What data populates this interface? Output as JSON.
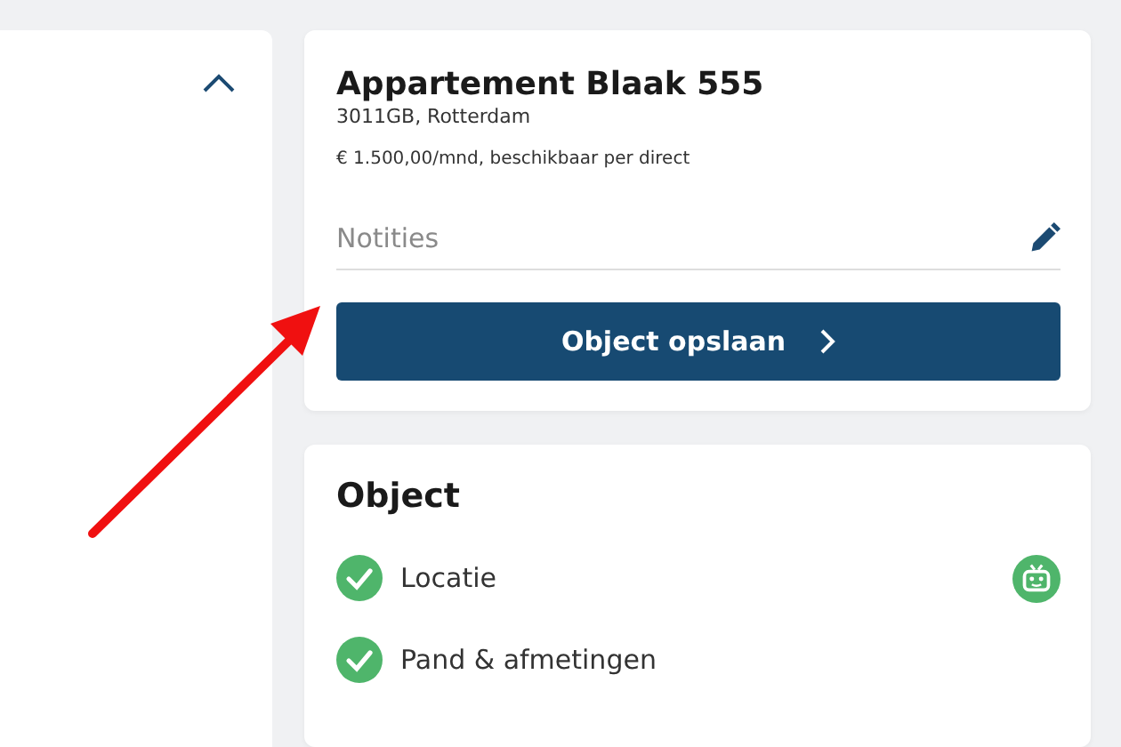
{
  "left_panel": {
    "expanded": true
  },
  "property": {
    "title": "Appartement Blaak 555",
    "address": "3011GB, Rotterdam",
    "price": "€ 1.500,00/mnd, beschikbaar per direct",
    "notes": {
      "placeholder": "Notities"
    },
    "save_button": "Object opslaan"
  },
  "object_section": {
    "title": "Object",
    "items": [
      {
        "label": "Locatie",
        "checked": true,
        "assistant": true
      },
      {
        "label": "Pand & afmetingen",
        "checked": true,
        "assistant": false
      }
    ]
  },
  "annotation": {
    "kind": "arrow"
  }
}
